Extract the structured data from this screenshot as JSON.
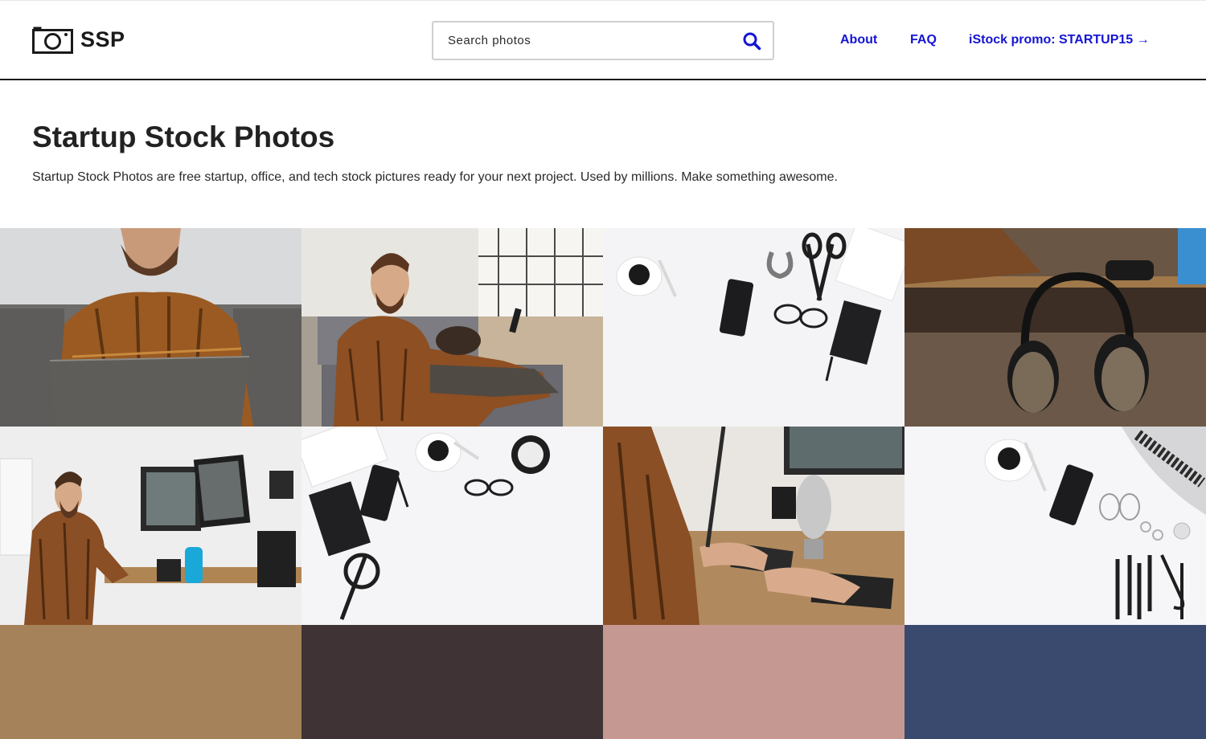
{
  "header": {
    "brand": "SSP",
    "search_placeholder": "Search photos",
    "nav": {
      "about": "About",
      "faq": "FAQ",
      "promo": "iStock promo: STARTUP15 →"
    }
  },
  "hero": {
    "title": "Startup Stock Photos",
    "description": "Startup Stock Photos are free startup, office, and tech stock pictures ready for your next project. Used by millions. Make something awesome."
  },
  "photos": [
    {
      "subject": "man-typing-on-laptop",
      "bg": "#8a7f74"
    },
    {
      "subject": "man-on-couch-with-phone",
      "bg": "#b9b2a6"
    },
    {
      "subject": "desk-flatlay-coffee-phone-glasses",
      "bg": "#f4f4f6"
    },
    {
      "subject": "headphones-hanging-under-desk",
      "bg": "#3a2a1e"
    },
    {
      "subject": "man-at-standing-desk-monitors",
      "bg": "#efefef"
    },
    {
      "subject": "flatlay-notebook-phone-clock",
      "bg": "#f5f5f7"
    },
    {
      "subject": "hands-keyboard-microphone",
      "bg": "#a5846a"
    },
    {
      "subject": "flatlay-coffee-phone-makeup",
      "bg": "#f6f6f8"
    },
    {
      "subject": "placeholder-tan",
      "bg": "#a5825a"
    },
    {
      "subject": "placeholder-dark",
      "bg": "#3f3335"
    },
    {
      "subject": "placeholder-rose",
      "bg": "#c59992"
    },
    {
      "subject": "placeholder-navy",
      "bg": "#3a4a6e"
    }
  ],
  "colors": {
    "link": "#1414d4",
    "header_border": "#1a1a1a",
    "text": "#222222"
  }
}
